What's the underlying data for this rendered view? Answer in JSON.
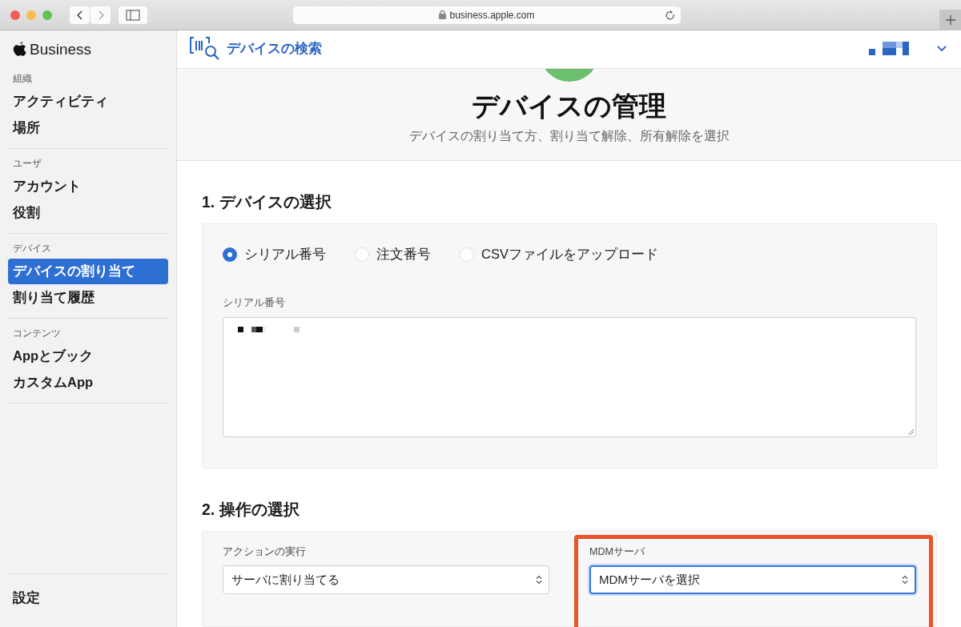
{
  "browser": {
    "url": "business.apple.com"
  },
  "sidebar": {
    "brand": "Business",
    "sections": [
      {
        "heading": "組織",
        "items": [
          {
            "label": "アクティビティ",
            "selected": false
          },
          {
            "label": "場所",
            "selected": false
          }
        ]
      },
      {
        "heading": "ユーザ",
        "items": [
          {
            "label": "アカウント",
            "selected": false
          },
          {
            "label": "役割",
            "selected": false
          }
        ]
      },
      {
        "heading": "デバイス",
        "items": [
          {
            "label": "デバイスの割り当て",
            "selected": true
          },
          {
            "label": "割り当て履歴",
            "selected": false
          }
        ]
      },
      {
        "heading": "コンテンツ",
        "items": [
          {
            "label": "Appとブック",
            "selected": false
          },
          {
            "label": "カスタムApp",
            "selected": false
          }
        ]
      }
    ],
    "footer_item": "設定"
  },
  "topbar": {
    "search_link": "デバイスの検索"
  },
  "header": {
    "title": "デバイスの管理",
    "subtitle": "デバイスの割り当て方、割り当て解除、所有解除を選択"
  },
  "step1": {
    "title": "1. デバイスの選択",
    "options": [
      {
        "label": "シリアル番号",
        "selected": true
      },
      {
        "label": "注文番号",
        "selected": false
      },
      {
        "label": "CSVファイルをアップロード",
        "selected": false
      }
    ],
    "field_label": "シリアル番号"
  },
  "step2": {
    "title": "2. 操作の選択",
    "action": {
      "label": "アクションの実行",
      "value": "サーバに割り当てる",
      "focused": false,
      "highlighted": false
    },
    "server": {
      "label": "MDMサーバ",
      "value": "MDMサーバを選択",
      "focused": true,
      "highlighted": true
    }
  }
}
